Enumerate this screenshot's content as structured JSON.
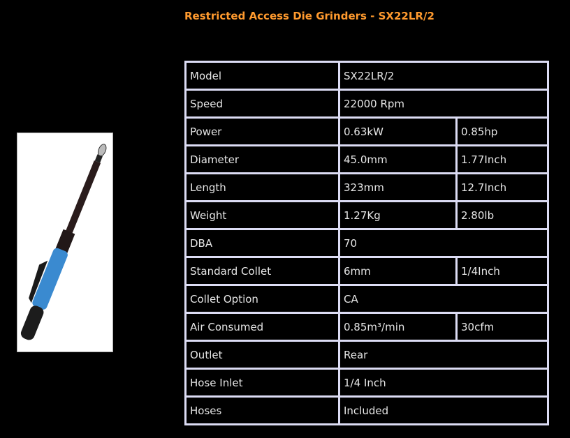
{
  "title": "Restricted Access Die Grinders - SX22LR/2",
  "rows": [
    {
      "label": "Model",
      "v1": "SX22LR/2"
    },
    {
      "label": "Speed",
      "v1": "22000 Rpm"
    },
    {
      "label": "Power",
      "v1": "0.63kW",
      "v2": "0.85hp"
    },
    {
      "label": "Diameter",
      "v1": "45.0mm",
      "v2": "1.77Inch"
    },
    {
      "label": "Length",
      "v1": "323mm",
      "v2": "12.7Inch"
    },
    {
      "label": "Weight",
      "v1": "1.27Kg",
      "v2": "2.80lb"
    },
    {
      "label": "DBA",
      "v1": "70"
    },
    {
      "label": "Standard Collet",
      "v1": "6mm",
      "v2": "1/4Inch"
    },
    {
      "label": "Collet Option",
      "v1": "CA"
    },
    {
      "label": "Air Consumed",
      "v1": "0.85m³/min",
      "v2": "30cfm"
    },
    {
      "label": "Outlet",
      "v1": "Rear"
    },
    {
      "label": "Hose Inlet",
      "v1": "1/4 Inch"
    },
    {
      "label": "Hoses",
      "v1": "Included"
    }
  ]
}
